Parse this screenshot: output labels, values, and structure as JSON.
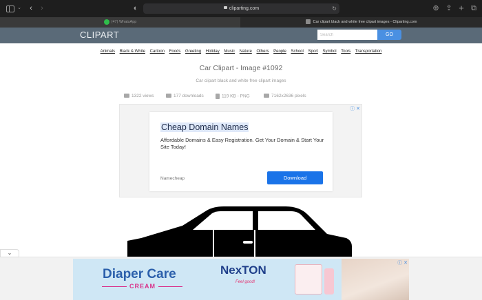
{
  "browser": {
    "url": "cliparting.com",
    "tabs": [
      {
        "label": "(47) WhatsApp"
      },
      {
        "label": "Car clipart black and white free clipart images - Cliparting.com"
      }
    ]
  },
  "site": {
    "logo": "CLIPART",
    "search_placeholder": "Search",
    "go_label": "GO"
  },
  "categories": [
    "Animals",
    "Black & White",
    "Cartoon",
    "Foods",
    "Greeting",
    "Holiday",
    "Music",
    "Nature",
    "Others",
    "People",
    "School",
    "Sport",
    "Symbol",
    "Tools",
    "Transportation"
  ],
  "image": {
    "title": "Car Clipart - Image #1092",
    "subtitle": "Car clipart black and white free clipart images",
    "views": "1322 views",
    "downloads": "177 downloads",
    "size": "119 KB - PNG",
    "dimensions": "7162x2636 pixels"
  },
  "ad_top": {
    "headline": "Cheap Domain Names",
    "body": "Affordable Domains & Easy Registration. Get Your Domain & Start Your Site Today!",
    "advertiser": "Namecheap",
    "button": "Download"
  },
  "ad_bottom": {
    "headline": "Diaper Care",
    "subline": "CREAM",
    "brand": "NexTON",
    "tagline": "Feel good!"
  }
}
